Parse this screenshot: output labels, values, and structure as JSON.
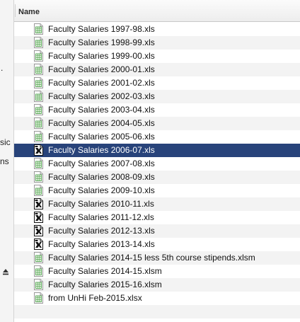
{
  "colors": {
    "selection": "#28437a",
    "stripe": "#f3f3f3",
    "spreadsheet_icon_accent": "#3f9a3c"
  },
  "sidebar": {
    "fragments": [
      {
        "text": "."
      },
      {
        "text": "sic"
      },
      {
        "text": "ns"
      }
    ],
    "eject_icon": "eject-icon"
  },
  "list": {
    "column_header": "Name",
    "files": [
      {
        "name": "Faculty Salaries 1997-98.xls",
        "icon": "spreadsheet-icon"
      },
      {
        "name": "Faculty Salaries 1998-99.xls",
        "icon": "spreadsheet-icon"
      },
      {
        "name": "Faculty Salaries 1999-00.xls",
        "icon": "spreadsheet-icon"
      },
      {
        "name": "Faculty Salaries 2000-01.xls",
        "icon": "spreadsheet-icon"
      },
      {
        "name": "Faculty Salaries 2001-02.xls",
        "icon": "spreadsheet-icon"
      },
      {
        "name": "Faculty Salaries 2002-03.xls",
        "icon": "spreadsheet-icon"
      },
      {
        "name": "Faculty Salaries 2003-04.xls",
        "icon": "spreadsheet-icon"
      },
      {
        "name": "Faculty Salaries 2004-05.xls",
        "icon": "spreadsheet-icon"
      },
      {
        "name": "Faculty Salaries 2005-06.xls",
        "icon": "spreadsheet-icon"
      },
      {
        "name": "Faculty Salaries 2006-07.xls",
        "icon": "excel-document-icon",
        "selected": true
      },
      {
        "name": "Faculty Salaries 2007-08.xls",
        "icon": "spreadsheet-icon"
      },
      {
        "name": "Faculty Salaries 2008-09.xls",
        "icon": "spreadsheet-icon"
      },
      {
        "name": "Faculty Salaries 2009-10.xls",
        "icon": "spreadsheet-icon"
      },
      {
        "name": "Faculty Salaries 2010-11.xls",
        "icon": "excel-document-icon"
      },
      {
        "name": "Faculty Salaries 2011-12.xls",
        "icon": "excel-document-icon"
      },
      {
        "name": "Faculty Salaries 2012-13.xls",
        "icon": "excel-document-icon"
      },
      {
        "name": "Faculty Salaries 2013-14.xls",
        "icon": "excel-document-icon"
      },
      {
        "name": "Faculty Salaries 2014-15 less 5th course stipends.xlsm",
        "icon": "spreadsheet-icon"
      },
      {
        "name": "Faculty Salaries 2014-15.xlsm",
        "icon": "spreadsheet-icon"
      },
      {
        "name": "Faculty Salaries 2015-16.xlsm",
        "icon": "spreadsheet-icon"
      },
      {
        "name": "from UnHi Feb-2015.xlsx",
        "icon": "spreadsheet-icon"
      }
    ]
  }
}
